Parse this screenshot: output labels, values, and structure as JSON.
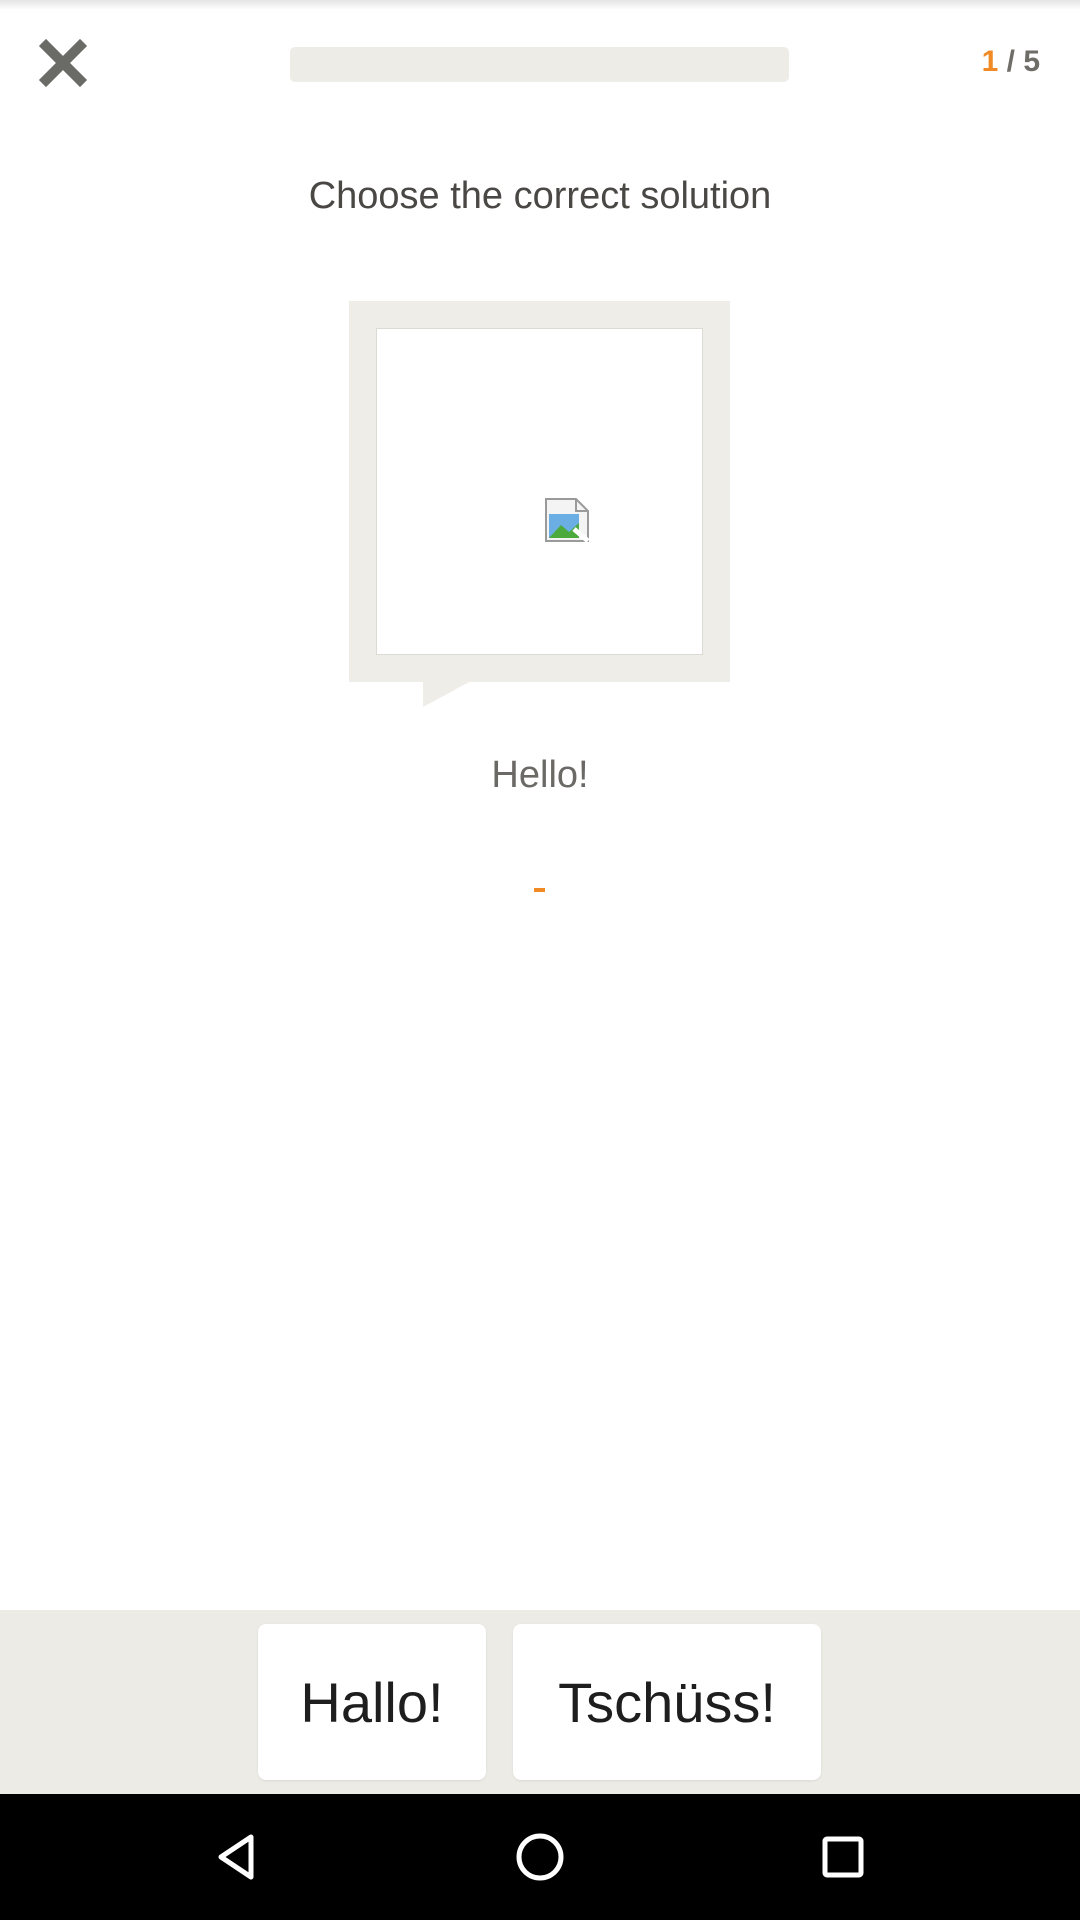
{
  "header": {
    "close_icon": "close-icon",
    "progress": {
      "fraction": 0.0
    },
    "counter": {
      "current": "1",
      "separator": " / ",
      "total": "5"
    }
  },
  "exercise": {
    "instruction": "Choose the correct solution",
    "image_icon": "broken-image-icon",
    "phrase": "Hello!"
  },
  "answers": [
    {
      "label": "Hallo!"
    },
    {
      "label": "Tschüss!"
    }
  ],
  "navigation": {
    "back_icon": "back-triangle-icon",
    "home_icon": "home-circle-icon",
    "recent_icon": "recent-apps-square-icon"
  },
  "colors": {
    "accent": "#f08a24",
    "track": "#eeece6",
    "answer_bar": "#ecebe6"
  }
}
